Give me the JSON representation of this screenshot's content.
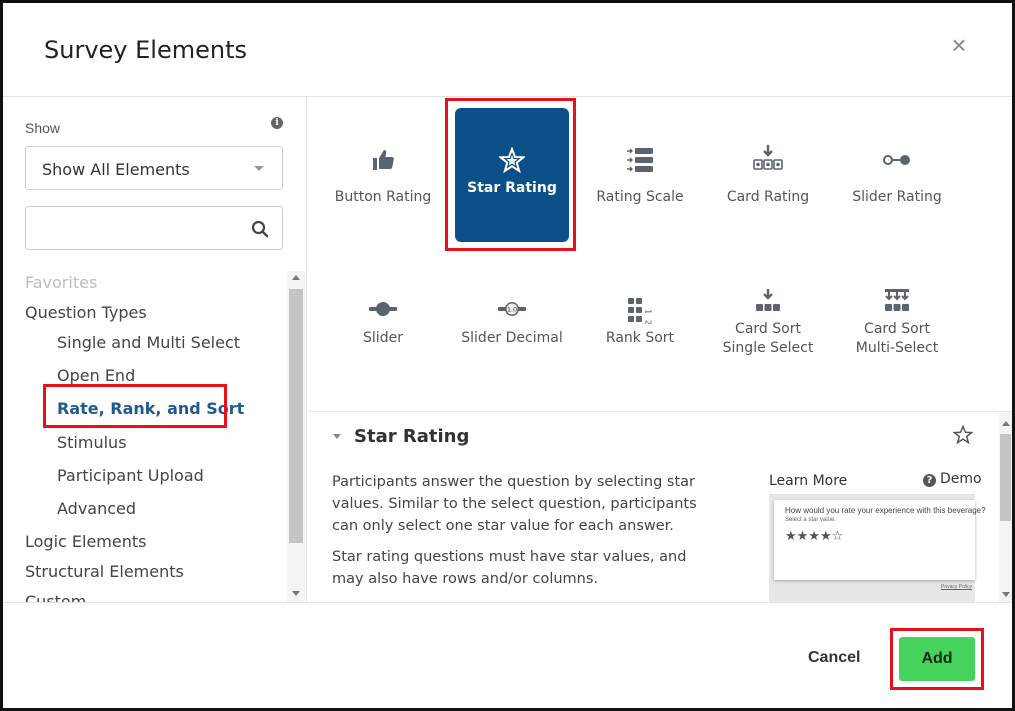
{
  "modal": {
    "title": "Survey Elements"
  },
  "sidebar": {
    "show_label": "Show",
    "show_select": "Show All Elements",
    "search_placeholder": "",
    "tree": [
      {
        "label": "Favorites",
        "level": 1,
        "state": "faded"
      },
      {
        "label": "Question Types",
        "level": 1,
        "state": "normal"
      },
      {
        "label": "Single and Multi Select",
        "level": 2,
        "state": "normal"
      },
      {
        "label": "Open End",
        "level": 2,
        "state": "normal"
      },
      {
        "label": "Rate, Rank, and Sort",
        "level": 2,
        "state": "active"
      },
      {
        "label": "Stimulus",
        "level": 2,
        "state": "normal"
      },
      {
        "label": "Participant Upload",
        "level": 2,
        "state": "normal"
      },
      {
        "label": "Advanced",
        "level": 2,
        "state": "normal"
      },
      {
        "label": "Logic Elements",
        "level": 1,
        "state": "normal"
      },
      {
        "label": "Structural Elements",
        "level": 1,
        "state": "normal"
      },
      {
        "label": "Custom",
        "level": 1,
        "state": "normal"
      }
    ]
  },
  "elements": [
    {
      "label": "Button Rating",
      "icon": "thumbs-up-icon",
      "selected": false
    },
    {
      "label": "Star Rating",
      "icon": "star-icon",
      "selected": true
    },
    {
      "label": "Rating Scale",
      "icon": "rating-scale-icon",
      "selected": false
    },
    {
      "label": "Card Rating",
      "icon": "card-rating-icon",
      "selected": false
    },
    {
      "label": "Slider Rating",
      "icon": "slider-rating-icon",
      "selected": false
    },
    {
      "label": "Slider",
      "icon": "slider-icon",
      "selected": false
    },
    {
      "label": "Slider Decimal",
      "icon": "slider-decimal-icon",
      "selected": false,
      "icon_text": "1.0"
    },
    {
      "label": "Rank Sort",
      "icon": "rank-sort-icon",
      "selected": false,
      "icon_text": "1 2 3"
    },
    {
      "label": "Card Sort\nSingle Select",
      "icon": "card-sort-single-icon",
      "selected": false
    },
    {
      "label": "Card Sort\nMulti-Select",
      "icon": "card-sort-multi-icon",
      "selected": false
    }
  ],
  "detail": {
    "title": "Star Rating",
    "description": [
      "Participants answer the question by selecting star values. Similar to the select question, participants can only select one star value for each answer.",
      "Star rating questions must have star values, and may also have rows and/or columns."
    ],
    "learn_more": "Learn More",
    "demo": "Demo",
    "preview": {
      "question": "How would you rate your experience with this beverage?",
      "instruction": "Select a star value.",
      "stars": "★★★★☆",
      "privacy": "Privacy Policy"
    }
  },
  "footer": {
    "cancel_label": "Cancel",
    "add_label": "Add"
  },
  "colors": {
    "selected_tile": "#0c5089",
    "active_link": "#1f5b91",
    "add_button": "#45d35e",
    "highlight": "#e8101a"
  }
}
